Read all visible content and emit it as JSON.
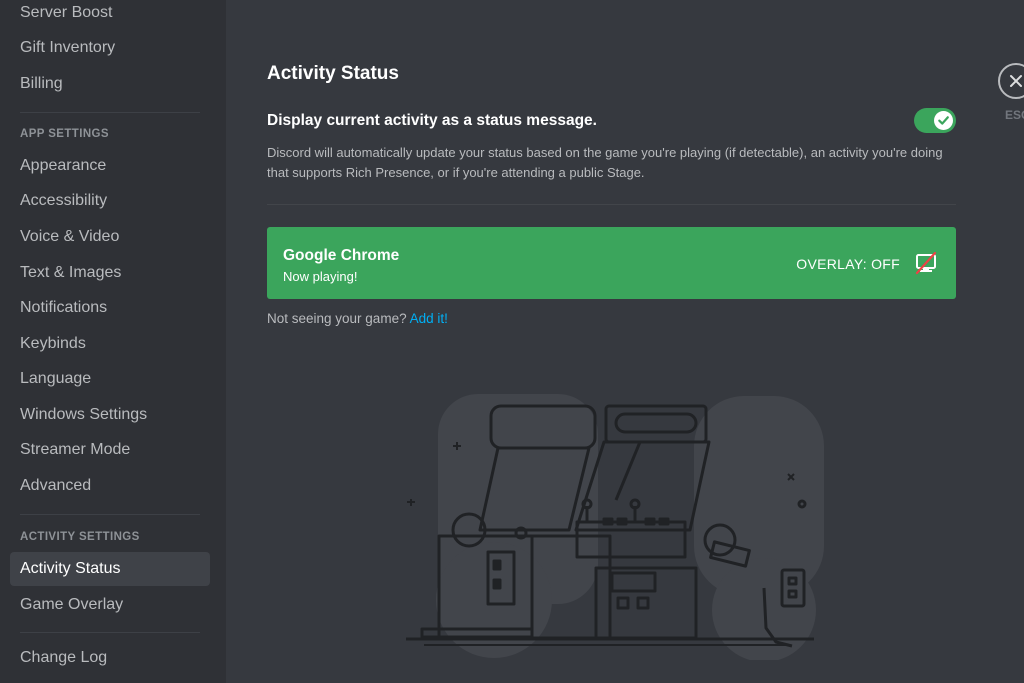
{
  "sidebar": {
    "top_items": [
      "Server Boost",
      "Gift Inventory",
      "Billing"
    ],
    "app_settings_header": "APP SETTINGS",
    "app_items": [
      "Appearance",
      "Accessibility",
      "Voice & Video",
      "Text & Images",
      "Notifications",
      "Keybinds",
      "Language",
      "Windows Settings",
      "Streamer Mode",
      "Advanced"
    ],
    "activity_settings_header": "ACTIVITY SETTINGS",
    "activity_items": [
      "Activity Status",
      "Game Overlay"
    ],
    "bottom_items": [
      "Change Log"
    ],
    "active_item": "Activity Status"
  },
  "main": {
    "title": "Activity Status",
    "toggle_label": "Display current activity as a status message.",
    "toggle_on": true,
    "description": "Discord will automatically update your status based on the game you're playing (if detectable), an activity you're doing that supports Rich Presence, or if you're attending a public Stage.",
    "game": {
      "name": "Google Chrome",
      "status": "Now playing!",
      "overlay": "OVERLAY: OFF"
    },
    "not_seeing": "Not seeing your game?",
    "add_link": "Add it!"
  },
  "close": {
    "label": "ESC",
    "icon": "close-icon"
  },
  "colors": {
    "accent_green": "#3ba55c",
    "link_blue": "#00aff4",
    "background": "#36393f",
    "sidebar": "#2f3136"
  }
}
